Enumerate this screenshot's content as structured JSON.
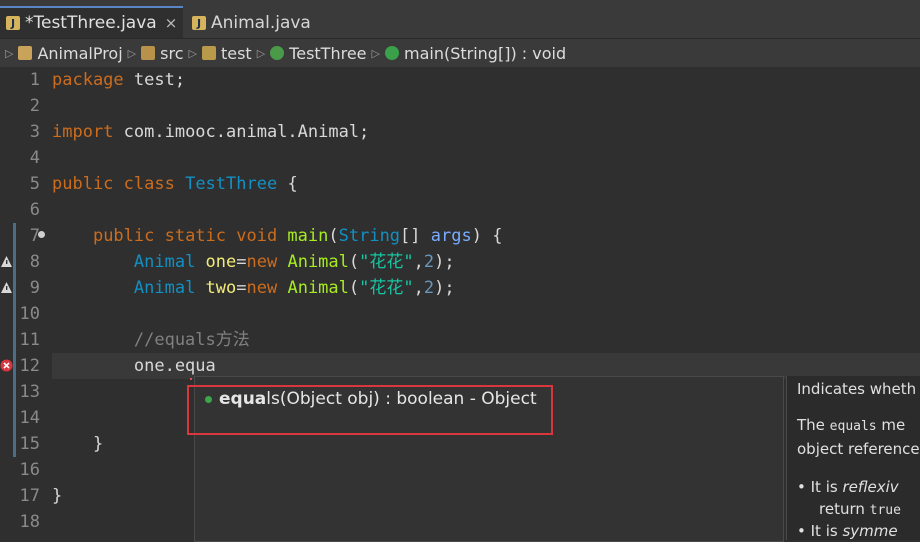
{
  "tabs": [
    {
      "label": "*TestThree.java",
      "close": "×"
    },
    {
      "label": "Animal.java"
    }
  ],
  "breadcrumb": [
    "AnimalProj",
    "src",
    "test",
    "TestThree",
    "main(String[]) : void"
  ],
  "lines": [
    "1",
    "2",
    "3",
    "4",
    "5",
    "6",
    "7",
    "8",
    "9",
    "10",
    "11",
    "12",
    "13",
    "14",
    "15",
    "16",
    "17",
    "18"
  ],
  "code": {
    "l1_kw": "package",
    "l1_rest": " test;",
    "l3_kw": "import",
    "l3_rest": " com.imooc.animal.Animal;",
    "l5_kw1": "public",
    "l5_kw2": " class",
    "l5_cls": " TestThree",
    "l5_rest": " {",
    "l7_ind": "    ",
    "l7_kw": "public static void",
    "l7_fn": " main",
    "l7_p1": "(",
    "l7_cls": "String",
    "l7_p2": "[] ",
    "l7_var": "args",
    "l7_p3": ") {",
    "l8_ind": "        ",
    "l8_cls": "Animal",
    "l8_var": " one",
    "l8_eq": "=",
    "l8_kw": "new",
    "l8_fn": " Animal",
    "l8_p1": "(",
    "l8_str": "\"花花\"",
    "l8_p2": ",",
    "l8_num": "2",
    "l8_p3": ");",
    "l9_ind": "        ",
    "l9_cls": "Animal",
    "l9_var": " two",
    "l9_eq": "=",
    "l9_kw": "new",
    "l9_fn": " Animal",
    "l9_p1": "(",
    "l9_str": "\"花花\"",
    "l9_p2": ",",
    "l9_num": "2",
    "l9_p3": ");",
    "l11": "        //equals方法",
    "l12": "        one.equa",
    "l15": "    }",
    "l17": "}"
  },
  "popup": {
    "bold": "equa",
    "rest": "ls(Object obj) : boolean - Object"
  },
  "doc": {
    "line1": "Indicates wheth",
    "line2a": "The ",
    "line2b": "equals",
    "line2c": " me",
    "line3": "object reference",
    "b1a": "• It is ",
    "b1b": "reflexiv",
    "b1c": "return ",
    "b1d": "true",
    "b2a": "• It is ",
    "b2b": "symme"
  },
  "colors": {
    "keyword": "#cc6c1d",
    "class": "#1290c3",
    "method": "#a7ec21",
    "string": "#17c6a3",
    "highlight": "#d9363e"
  }
}
